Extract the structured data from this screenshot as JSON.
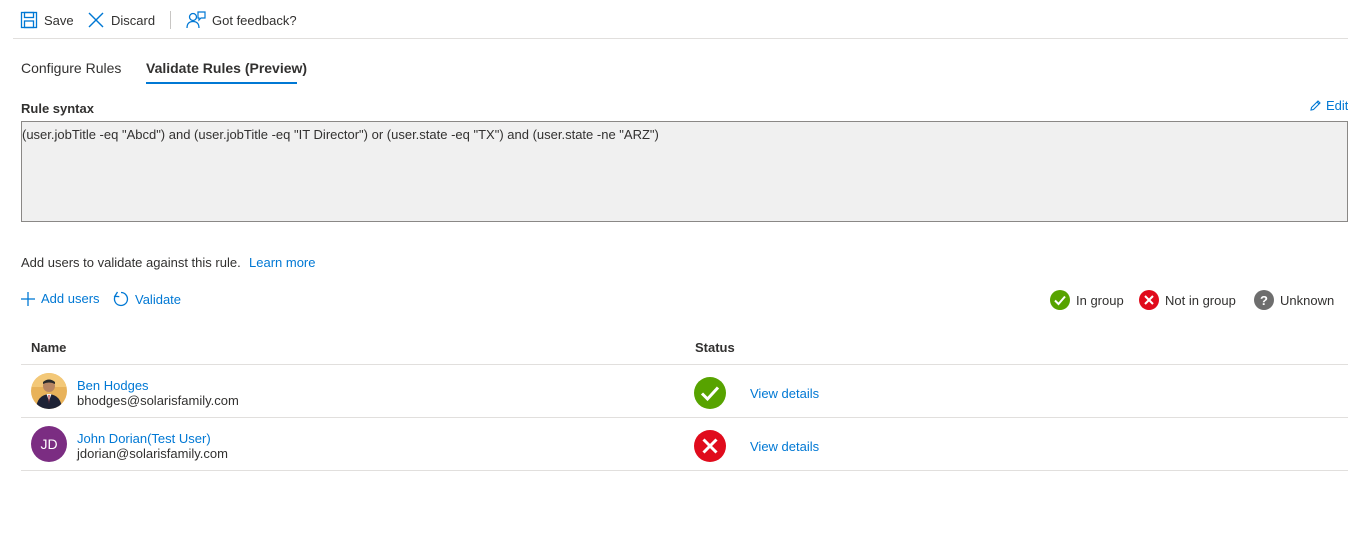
{
  "toolbar": {
    "save_label": "Save",
    "discard_label": "Discard",
    "feedback_label": "Got feedback?"
  },
  "tabs": [
    {
      "label": "Configure Rules",
      "active": false
    },
    {
      "label": "Validate Rules (Preview)",
      "active": true
    }
  ],
  "rule": {
    "label": "Rule syntax",
    "edit_label": "Edit",
    "syntax": "(user.jobTitle -eq \"Abcd\") and (user.jobTitle -eq \"IT Director\") or (user.state -eq \"TX\") and (user.state -ne \"ARZ\")"
  },
  "validate": {
    "hint": "Add users to validate against this rule.",
    "learn_more": "Learn more",
    "add_users_label": "Add users",
    "validate_label": "Validate"
  },
  "legend": {
    "in_group": "In group",
    "not_in_group": "Not in group",
    "unknown": "Unknown"
  },
  "table": {
    "columns": {
      "name": "Name",
      "status": "Status"
    },
    "rows": [
      {
        "name": "Ben Hodges",
        "email": "bhodges@solarisfamily.com",
        "status": "in-group",
        "action": "View details"
      },
      {
        "name": "John Dorian(Test User)",
        "email": "jdorian@solarisfamily.com",
        "initials": "JD",
        "status": "not-in-group",
        "action": "View details"
      }
    ]
  },
  "colors": {
    "accent": "#0078d4",
    "success": "#57a300",
    "error": "#e00b1c",
    "unknown": "#6e6e6e",
    "avatar_jd": "#7b2d82"
  },
  "icons": [
    "save-icon",
    "discard-icon",
    "feedback-icon",
    "edit-icon",
    "add-icon",
    "refresh-icon",
    "check-circle-icon",
    "error-circle-icon",
    "question-circle-icon"
  ]
}
